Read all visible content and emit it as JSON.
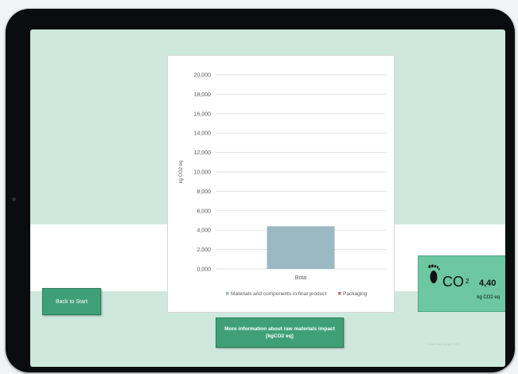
{
  "ui": {
    "back_button": "Back to Start",
    "info_button": "More information about raw materials impact [kgCO2 eq]",
    "co2": {
      "label": "CO",
      "subscript": "2",
      "value": "4,40",
      "unit": "kg CO2 eq",
      "icon": "footprint-icon"
    },
    "watermark": "Sole Bota Haute 2023"
  },
  "colors": {
    "screen_bg": "#cfe8de",
    "button_green": "#3fa078",
    "co2_card": "#6cc7a2",
    "bar_fill": "#9bb9c2",
    "legend_materials": "#7fa9b6",
    "legend_packaging": "#d06870"
  },
  "chart_data": {
    "type": "bar",
    "categories": [
      "Bota"
    ],
    "series": [
      {
        "name": "Materials and components in final product",
        "values": [
          4.4
        ],
        "color": "#9bb9c2"
      },
      {
        "name": "Packaging",
        "values": [
          0
        ],
        "color": "#d06870"
      }
    ],
    "title": "",
    "xlabel": "",
    "ylabel": "kg CO2 eq",
    "ylim": [
      0,
      20
    ],
    "yticks": [
      0,
      2,
      4,
      6,
      8,
      10,
      12,
      14,
      16,
      18,
      20
    ],
    "ytick_labels": [
      "0,000",
      "2,000",
      "4,000",
      "6,000",
      "8,000",
      "10,000",
      "12,000",
      "14,000",
      "16,000",
      "18,000",
      "20,000"
    ],
    "grid": true,
    "legend_position": "bottom"
  }
}
